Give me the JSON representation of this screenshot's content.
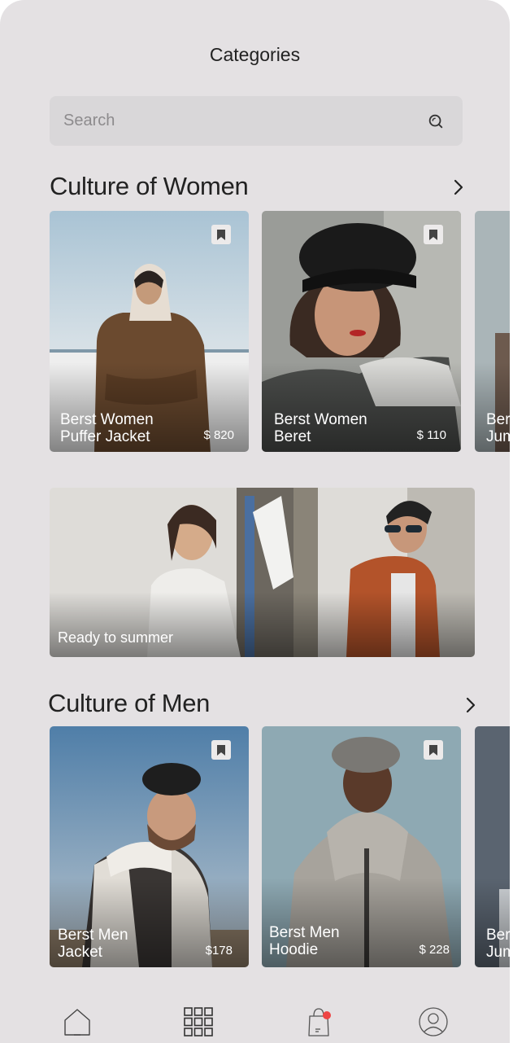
{
  "header": {
    "title": "Categories"
  },
  "search": {
    "placeholder": "Search"
  },
  "women": {
    "title": "Culture of Women",
    "cards": [
      {
        "line1": "Berst Women",
        "line2": "Puffer Jacket",
        "price": "$ 820"
      },
      {
        "line1": "Berst Women",
        "line2": "Beret",
        "price": "$ 110"
      }
    ],
    "partial": {
      "line1": "Ber",
      "line2": "Jum"
    }
  },
  "banner": {
    "text": "Ready to summer"
  },
  "men": {
    "title": "Culture of Men",
    "cards": [
      {
        "line1": "Berst Men",
        "line2": "Jacket",
        "price": "$178"
      },
      {
        "line1": "Berst Men",
        "line2": "Hoodie",
        "price": "$ 228"
      }
    ],
    "partial": {
      "line1": "Ber",
      "line2": "Jum"
    }
  },
  "nav": {
    "items": [
      "home-icon",
      "grid-icon",
      "bag-icon",
      "profile-icon"
    ],
    "badge_color": "#ee4444"
  }
}
